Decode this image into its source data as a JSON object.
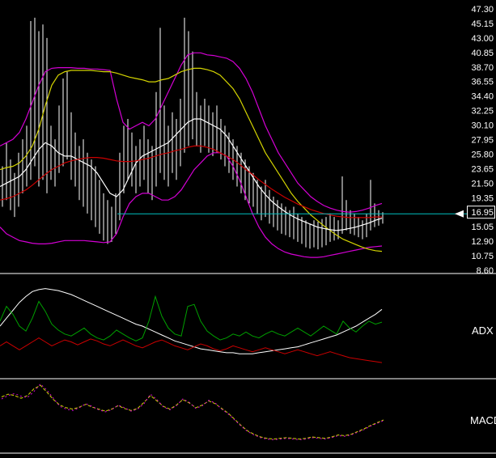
{
  "colors": {
    "background": "#000000",
    "bar": "#ffffff",
    "magenta": "#d400d4",
    "yellow": "#d4d400",
    "white": "#ffffff",
    "red": "#cc0000",
    "green": "#00a000",
    "cyan": "#00c0c0",
    "separator": "#ffffff",
    "axis_text": "#ffffff"
  },
  "price_axis": {
    "labels": [
      "47.30",
      "45.15",
      "43.00",
      "40.85",
      "38.70",
      "36.55",
      "34.40",
      "32.25",
      "30.10",
      "27.95",
      "25.80",
      "23.65",
      "21.50",
      "19.35",
      "16.95",
      "15.05",
      "12.90",
      "10.75",
      "8.60"
    ],
    "current_index": 14,
    "current_label": "16.95"
  },
  "panels": {
    "adx_label": "ADX",
    "macd_label": "MACD"
  },
  "chart_data": [
    {
      "type": "bar",
      "name": "price",
      "ylim": [
        8.6,
        47.3
      ],
      "current_price": 16.95,
      "current_price_label": "16.95",
      "current_price_color": "#00c0c0",
      "bars_high_low": [
        [
          24,
          18
        ],
        [
          27.5,
          19
        ],
        [
          25,
          17.5
        ],
        [
          23,
          16.5
        ],
        [
          26,
          18
        ],
        [
          28,
          20
        ],
        [
          30,
          21
        ],
        [
          45.5,
          22
        ],
        [
          46,
          24
        ],
        [
          44,
          21
        ],
        [
          45,
          22
        ],
        [
          43,
          20
        ],
        [
          30,
          22
        ],
        [
          28,
          21
        ],
        [
          33,
          23
        ],
        [
          37,
          24
        ],
        [
          38,
          25
        ],
        [
          32,
          22
        ],
        [
          29,
          21
        ],
        [
          27,
          19
        ],
        [
          28,
          18
        ],
        [
          26,
          17
        ],
        [
          25,
          16
        ],
        [
          24,
          15
        ],
        [
          22,
          14
        ],
        [
          20,
          13
        ],
        [
          19,
          12.5
        ],
        [
          18,
          12.8
        ],
        [
          20,
          14
        ],
        [
          26,
          16
        ],
        [
          30,
          20
        ],
        [
          31,
          22
        ],
        [
          29,
          21
        ],
        [
          27,
          20
        ],
        [
          28,
          21
        ],
        [
          30,
          22
        ],
        [
          28,
          20
        ],
        [
          27,
          19
        ],
        [
          35,
          21
        ],
        [
          44.5,
          23
        ],
        [
          33,
          22
        ],
        [
          30,
          21
        ],
        [
          32,
          23
        ],
        [
          31,
          22
        ],
        [
          34,
          24
        ],
        [
          46,
          26
        ],
        [
          44,
          27
        ],
        [
          41,
          28
        ],
        [
          35,
          27
        ],
        [
          33,
          26
        ],
        [
          34,
          27
        ],
        [
          33,
          26
        ],
        [
          32,
          25.5
        ],
        [
          33,
          26
        ],
        [
          31,
          25
        ],
        [
          30,
          24
        ],
        [
          29,
          23
        ],
        [
          28,
          22
        ],
        [
          27,
          21
        ],
        [
          26,
          20
        ],
        [
          25,
          19
        ],
        [
          24,
          18.5
        ],
        [
          23,
          18
        ],
        [
          22,
          17
        ],
        [
          21,
          16
        ],
        [
          22,
          16.5
        ],
        [
          20.5,
          15.5
        ],
        [
          19.5,
          15
        ],
        [
          19,
          14.5
        ],
        [
          18.5,
          14
        ],
        [
          18,
          13.8
        ],
        [
          17.5,
          13.5
        ],
        [
          18,
          13.2
        ],
        [
          17,
          12.8
        ],
        [
          16.5,
          12.5
        ],
        [
          16,
          12
        ],
        [
          15.5,
          11.8
        ],
        [
          16,
          12
        ],
        [
          15.8,
          11.7
        ],
        [
          16.2,
          12
        ],
        [
          16.5,
          12.3
        ],
        [
          17,
          12.8
        ],
        [
          16.5,
          13
        ],
        [
          16,
          13.2
        ],
        [
          22.5,
          14
        ],
        [
          19,
          14.5
        ],
        [
          17.5,
          14
        ],
        [
          17,
          13.8
        ],
        [
          16.5,
          13.5
        ],
        [
          16,
          13.2
        ],
        [
          17,
          13.5
        ],
        [
          22,
          14.5
        ],
        [
          18.5,
          15
        ],
        [
          17.5,
          15.2
        ],
        [
          17.2,
          15.5
        ]
      ],
      "series": [
        {
          "name": "bollinger-upper",
          "color": "#d400d4",
          "values": [
            27,
            27.5,
            28,
            29,
            31,
            33.5,
            36,
            38,
            38.5,
            38.6,
            38.6,
            38.6,
            38.5,
            38.5,
            38.4,
            38.4,
            38.3,
            38.2,
            34,
            30.5,
            29.5,
            30,
            30.5,
            30,
            31,
            33,
            35,
            37,
            39,
            40.5,
            40.8,
            40.8,
            40.5,
            40.4,
            40.2,
            40,
            39.5,
            38.5,
            37,
            35,
            32.5,
            30,
            28,
            26,
            24.5,
            23,
            21.5,
            20.5,
            19.5,
            18.8,
            18.2,
            17.8,
            17.5,
            17.3,
            17.2,
            17.3,
            17.5,
            17.8,
            18.2,
            18.5
          ]
        },
        {
          "name": "bollinger-lower",
          "color": "#d400d4",
          "values": [
            15,
            14,
            13.5,
            13,
            12.8,
            12.6,
            12.5,
            12.5,
            12.6,
            12.8,
            13,
            13,
            13,
            13,
            12.9,
            12.8,
            12.7,
            12.8,
            14,
            16.5,
            18.5,
            19.5,
            20,
            20,
            19.5,
            19,
            19,
            19.5,
            20.5,
            22,
            23.5,
            24.5,
            25.5,
            26,
            26,
            25.5,
            24,
            22,
            19.5,
            17,
            15,
            13.5,
            12.5,
            11.8,
            11.3,
            11,
            10.8,
            10.6,
            10.5,
            10.5,
            10.6,
            10.8,
            11,
            11.2,
            11.4,
            11.6,
            11.8,
            12,
            12.1,
            12.2
          ]
        },
        {
          "name": "ma-yellow",
          "color": "#d4d400",
          "values": [
            23.5,
            23.8,
            24,
            24.5,
            25.5,
            27,
            29.5,
            33,
            36,
            37.5,
            38,
            38.2,
            38.2,
            38.2,
            38.2,
            38.1,
            38,
            38,
            37.8,
            37.5,
            37.2,
            37,
            36.8,
            36.5,
            36.5,
            36.8,
            37,
            37.5,
            38,
            38.3,
            38.5,
            38.5,
            38.3,
            38,
            37.5,
            36.5,
            35.5,
            34,
            32,
            30,
            28,
            26,
            24.5,
            23,
            21.5,
            20,
            18.8,
            17.8,
            16.8,
            16,
            15.2,
            14.5,
            13.8,
            13.2,
            12.8,
            12.4,
            12,
            11.7,
            11.5,
            11.4
          ]
        },
        {
          "name": "ma-white",
          "color": "#ffffff",
          "values": [
            21,
            21.5,
            22,
            22.5,
            23.5,
            25,
            26.5,
            27.5,
            27,
            26,
            25.5,
            25.5,
            25,
            24.5,
            24,
            23,
            21.5,
            20,
            19.5,
            20.5,
            22.5,
            24.5,
            25.5,
            26,
            26.5,
            27,
            27.5,
            28.5,
            29.5,
            30.5,
            31,
            31,
            30.5,
            30,
            29.5,
            28.5,
            27,
            25.5,
            24,
            22.5,
            21,
            19.8,
            18.8,
            18,
            17.3,
            16.7,
            16.2,
            15.8,
            15.4,
            15,
            14.8,
            14.6,
            14.5,
            14.6,
            14.8,
            15,
            15.3,
            15.6,
            16,
            16.3
          ]
        },
        {
          "name": "ma-red",
          "color": "#cc0000",
          "values": [
            19,
            19.2,
            19.5,
            20,
            20.5,
            21.2,
            22,
            22.8,
            23.5,
            24,
            24.5,
            24.8,
            25,
            25.2,
            25.3,
            25.3,
            25.2,
            25,
            24.8,
            24.7,
            24.7,
            24.8,
            25,
            25.2,
            25.5,
            25.8,
            26,
            26.3,
            26.5,
            26.8,
            27,
            27,
            26.8,
            26.5,
            26,
            25.5,
            25,
            24.3,
            23.5,
            22.8,
            22,
            21.3,
            20.6,
            20,
            19.4,
            18.9,
            18.4,
            18,
            17.6,
            17.3,
            17,
            16.8,
            16.6,
            16.5,
            16.4,
            16.4,
            16.4,
            16.4,
            16.5,
            16.5
          ]
        }
      ]
    },
    {
      "type": "line",
      "name": "ADX",
      "ylim": [
        0,
        100
      ],
      "series": [
        {
          "name": "adx",
          "color": "#ffffff",
          "values": [
            50,
            58,
            66,
            74,
            80,
            85,
            87,
            88,
            87,
            86,
            84,
            82,
            79,
            76,
            73,
            70,
            67,
            64,
            61,
            58,
            55,
            52,
            50,
            47,
            44,
            41,
            38,
            35,
            33,
            31,
            29,
            27,
            26,
            25,
            24,
            23,
            23,
            22,
            22,
            22,
            23,
            24,
            25,
            26,
            27,
            28,
            29,
            31,
            33,
            35,
            37,
            39,
            41,
            44,
            47,
            50,
            54,
            58,
            62,
            67
          ]
        },
        {
          "name": "di-plus",
          "color": "#00a000",
          "values": [
            55,
            70,
            62,
            50,
            45,
            58,
            75,
            65,
            52,
            46,
            42,
            40,
            44,
            48,
            42,
            38,
            36,
            40,
            46,
            42,
            38,
            35,
            38,
            55,
            80,
            60,
            48,
            42,
            40,
            70,
            72,
            55,
            45,
            40,
            36,
            38,
            42,
            40,
            44,
            40,
            38,
            42,
            45,
            42,
            40,
            44,
            48,
            44,
            40,
            45,
            50,
            46,
            42,
            55,
            48,
            44,
            50,
            55,
            52,
            54
          ]
        },
        {
          "name": "di-minus",
          "color": "#cc0000",
          "values": [
            30,
            34,
            30,
            26,
            30,
            34,
            38,
            34,
            30,
            33,
            36,
            34,
            31,
            34,
            37,
            35,
            32,
            30,
            33,
            36,
            33,
            30,
            28,
            31,
            34,
            36,
            33,
            30,
            28,
            26,
            29,
            32,
            30,
            27,
            25,
            27,
            30,
            28,
            26,
            24,
            26,
            28,
            26,
            24,
            22,
            24,
            26,
            24,
            22,
            20,
            22,
            24,
            22,
            20,
            18,
            17,
            16,
            15,
            14,
            13
          ]
        }
      ]
    },
    {
      "type": "line",
      "name": "MACD",
      "ylim": [
        0,
        100
      ],
      "series": [
        {
          "name": "macd",
          "color": "#d4d400",
          "dash": "4 2",
          "values": [
            78,
            82,
            80,
            76,
            80,
            90,
            95,
            85,
            74,
            66,
            62,
            60,
            63,
            67,
            63,
            60,
            57,
            60,
            65,
            61,
            58,
            61,
            70,
            80,
            72,
            64,
            60,
            66,
            74,
            69,
            62,
            66,
            72,
            68,
            61,
            54,
            45,
            36,
            28,
            23,
            19,
            17,
            16,
            17,
            18,
            17,
            16,
            17,
            19,
            18,
            17,
            19,
            22,
            21,
            23,
            27,
            31,
            36,
            40,
            44
          ]
        },
        {
          "name": "signal",
          "color": "#d400d4",
          "dash": "2 3",
          "values": [
            75,
            80,
            83,
            79,
            77,
            86,
            97,
            88,
            76,
            64,
            60,
            58,
            62,
            68,
            64,
            59,
            56,
            59,
            66,
            62,
            57,
            60,
            68,
            82,
            74,
            63,
            59,
            65,
            75,
            70,
            61,
            65,
            73,
            69,
            60,
            53,
            44,
            35,
            27,
            22,
            18,
            16,
            15,
            16,
            17,
            16,
            15,
            16,
            18,
            17,
            16,
            18,
            21,
            20,
            22,
            26,
            30,
            35,
            39,
            43
          ]
        }
      ]
    }
  ]
}
